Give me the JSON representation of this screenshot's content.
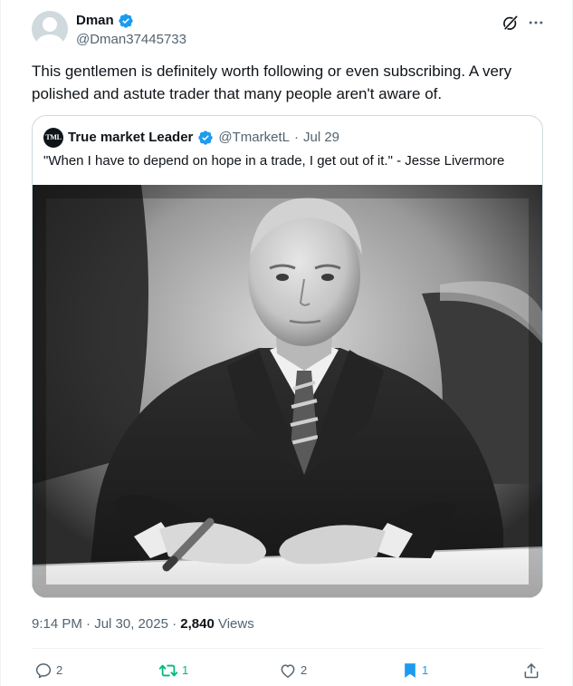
{
  "author": {
    "display_name": "Dman",
    "handle": "@Dman37445733",
    "verified": true
  },
  "tweet": {
    "text": "This gentlemen is definitely worth following or even subscribing. A very polished and astute trader that many people aren't aware of."
  },
  "quoted": {
    "logo_text": "TML",
    "display_name": "True market Leader",
    "verified": true,
    "handle": "@TmarketL",
    "separator": "·",
    "date": "Jul 29",
    "text": "\"When I have to depend on hope in a trade, I get out of it.\" -  Jesse Livermore",
    "photo": "black-and-white-portrait"
  },
  "meta": {
    "timestamp": "9:14 PM · Jul 30, 2025 · ",
    "views_count": "2,840",
    "views_label": " Views"
  },
  "actions": {
    "replies": "2",
    "reposts": "1",
    "likes": "2",
    "bookmarks": "1"
  },
  "icons": [
    "verified-badge-icon",
    "grok-icon",
    "more-icon",
    "reply-icon",
    "repost-icon",
    "like-icon",
    "bookmark-icon",
    "share-icon"
  ],
  "colors": {
    "text": "#0f1419",
    "secondary": "#536471",
    "verified": "#1d9bf0",
    "repost_active": "#00ba7c",
    "bookmark_active": "#1d9bf0",
    "border": "#cfd9de"
  }
}
